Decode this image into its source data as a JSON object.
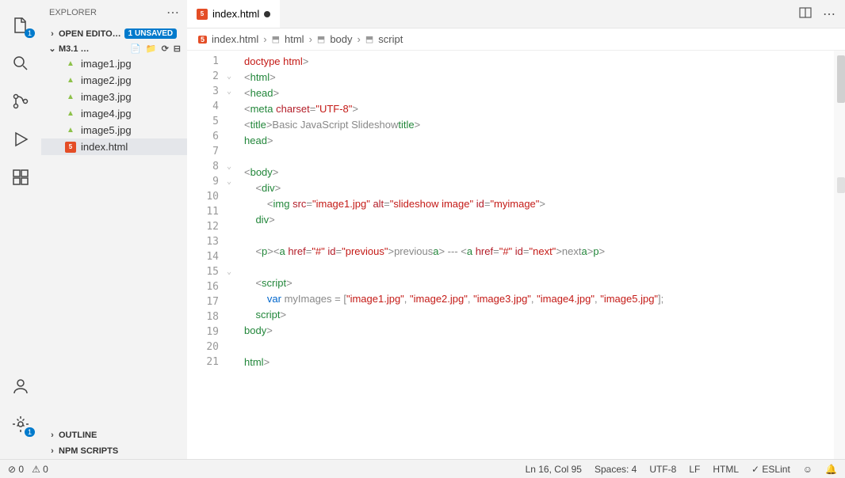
{
  "sidebar": {
    "title": "EXPLORER",
    "openEditors": {
      "label": "OPEN EDITO…",
      "unsaved": "1 UNSAVED"
    },
    "folder": {
      "name": "M3.1 …"
    },
    "files": [
      {
        "name": "image1.jpg",
        "type": "img"
      },
      {
        "name": "image2.jpg",
        "type": "img"
      },
      {
        "name": "image3.jpg",
        "type": "img"
      },
      {
        "name": "image4.jpg",
        "type": "img"
      },
      {
        "name": "image5.jpg",
        "type": "img"
      },
      {
        "name": "index.html",
        "type": "html",
        "active": true
      }
    ],
    "outline": "OUTLINE",
    "npm": "NPM SCRIPTS"
  },
  "tab": {
    "label": "index.html"
  },
  "breadcrumb": {
    "file": "index.html",
    "p1": "html",
    "p2": "body",
    "p3": "script"
  },
  "code": {
    "lines": 21,
    "l1": {
      "a": "<!",
      "b": "doctype html",
      "c": ">"
    },
    "l2": {
      "a": "<",
      "b": "html",
      "c": ">"
    },
    "l3": {
      "a": "<",
      "b": "head",
      "c": ">"
    },
    "l4": {
      "a": "<",
      "b": "meta",
      "attr1": " charset",
      "eq": "=",
      "v": "\"UTF-8\"",
      "c": ">"
    },
    "l5": {
      "a": "<",
      "b": "title",
      "c": ">",
      "t": "Basic JavaScript Slideshow",
      "a2": "</",
      "b2": "title",
      "c2": ">"
    },
    "l6": {
      "a": "</",
      "b": "head",
      "c": ">"
    },
    "l8": {
      "a": "<",
      "b": "body",
      "c": ">"
    },
    "l9": {
      "a": "<",
      "b": "div",
      "c": ">"
    },
    "l10": {
      "a": "<",
      "b": "img",
      "attr1": " src",
      "v1": "\"image1.jpg\"",
      "attr2": " alt",
      "v2": "\"slideshow image\"",
      "attr3": " id",
      "v3": "\"myimage\"",
      "c": ">"
    },
    "l11": {
      "a": "</",
      "b": "div",
      "c": ">"
    },
    "l13": {
      "a": "<",
      "p": "p",
      "c": ">",
      "a2": "<",
      "atag": "a",
      "href": " href",
      "hv": "\"#\"",
      "id": " id",
      "idv": "\"previous\"",
      "c2": ">",
      "t1": "previous",
      "a3": "</",
      "c3": "> --- ",
      "a4": "<",
      "hv2": "\"#\"",
      "idv2": "\"next\"",
      "c4": ">",
      "t2": "next",
      "a5": "</",
      "c5": "></",
      "c6": ">"
    },
    "l15": {
      "a": "<",
      "b": "script",
      "c": ">"
    },
    "l16": {
      "kw": "var",
      "vn": " myImages ",
      "eq": "= [",
      "s1": "\"image1.jpg\"",
      "s2": "\"image2.jpg\"",
      "s3": "\"image3.jpg\"",
      "s4": "\"image4.jpg\"",
      "s5": "\"image5.jpg\"",
      "end": "];"
    },
    "l17": {
      "a": "</",
      "b": "script",
      "c": ">"
    },
    "l18": {
      "a": "</",
      "b": "body",
      "c": ">"
    },
    "l20": {
      "a": "</",
      "b": "html",
      "c": ">"
    }
  },
  "status": {
    "errors": "0",
    "warnings": "0",
    "pos": "Ln 16, Col 95",
    "spaces": "Spaces: 4",
    "enc": "UTF-8",
    "eol": "LF",
    "lang": "HTML",
    "eslint": "ESLint"
  },
  "activityBadges": {
    "explorer": "1",
    "settings": "1"
  }
}
